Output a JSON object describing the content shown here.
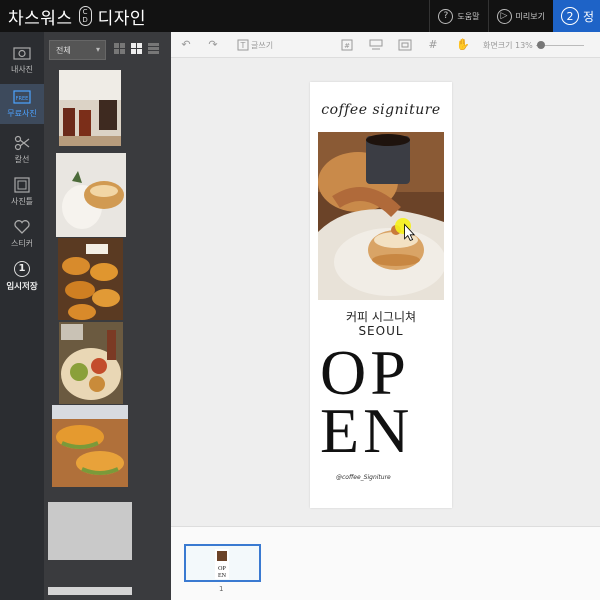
{
  "header": {
    "brand_left": "차스워스",
    "brand_right": "디자인",
    "logo_top": "C",
    "logo_bottom": "D",
    "help_label": "도움말",
    "help_icon": "question-icon",
    "preview_label": "미리보기",
    "preview_icon": "play-icon",
    "step_number": "2",
    "step_label": "정"
  },
  "rail": {
    "items": [
      {
        "label": "내사진",
        "icon": "camera-icon"
      },
      {
        "label": "무료사진",
        "icon": "free-photo-icon"
      },
      {
        "label": "칼선",
        "icon": "scissors-icon"
      },
      {
        "label": "사진틀",
        "icon": "frame-icon"
      },
      {
        "label": "스티커",
        "icon": "heart-icon"
      },
      {
        "label": "임시저장",
        "icon": "save-number-icon",
        "number": "1"
      }
    ]
  },
  "panel": {
    "filter_value": "전체"
  },
  "toolbar": {
    "write_label": "글쓰기",
    "zoom_label": "화면크기 13%"
  },
  "poster": {
    "script_title": "coffee signiture",
    "korean_name": "커피 시그니쳐",
    "city": "SEOUL",
    "open_line1": "OP",
    "open_line2": "EN",
    "handle": "@coffee_Signiture"
  },
  "pages": {
    "current": "1"
  },
  "colors": {
    "accent": "#1e63c7",
    "topbar": "#121212",
    "rail": "#2b2d31",
    "panel": "#3a3b3e"
  }
}
